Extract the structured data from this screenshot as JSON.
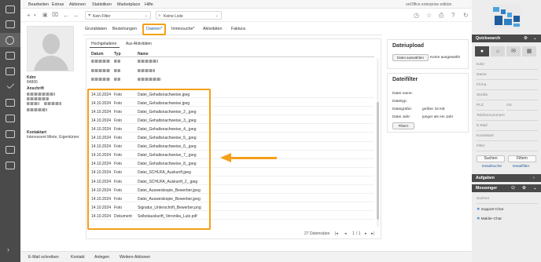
{
  "menu": {
    "items": [
      "Bearbeiten",
      "Extras",
      "Aktionen",
      "Statistiken",
      "Marketplace",
      "Hilfe"
    ],
    "edition": "onOffice enterprise edition"
  },
  "toolbar": {
    "filter_select": "Kein Filter",
    "list_select": "Keine Liste"
  },
  "record": {
    "name_label": "Kdnr",
    "kdnr": "84806",
    "address_label": "Anschrift",
    "contact_label": "Kontaktart",
    "contact_value": "Interessent Miete, Eigentümer"
  },
  "tabs": [
    {
      "label": "Grunddaten"
    },
    {
      "label": "Beziehungen"
    },
    {
      "label": "Dateien*"
    },
    {
      "label": "Immosuche*"
    },
    {
      "label": "Aktivitäten"
    },
    {
      "label": "Faktura"
    }
  ],
  "files": {
    "subtabs": [
      "Hochgeladene",
      "Aus Aktivitäten"
    ],
    "columns": [
      "Datum",
      "Typ",
      "Name"
    ],
    "rows": [
      {
        "date": "14.10.2024",
        "type": "Foto",
        "name": "Datei_Gehaltsnachweise.jpeg"
      },
      {
        "date": "14.10.2024",
        "type": "Foto",
        "name": "Datei_Gehaltsnachweise.jpeg"
      },
      {
        "date": "14.10.2024",
        "type": "Foto",
        "name": "Datei_Gehaltsnachweise_2_.jpeg"
      },
      {
        "date": "14.10.2024",
        "type": "Foto",
        "name": "Datei_Gehaltsnachweise_3_.jpeg"
      },
      {
        "date": "14.10.2024",
        "type": "Foto",
        "name": "Datei_Gehaltsnachweise_4_.jpeg"
      },
      {
        "date": "14.10.2024",
        "type": "Foto",
        "name": "Datei_Gehaltsnachweise_5_.jpeg"
      },
      {
        "date": "14.10.2024",
        "type": "Foto",
        "name": "Datei_Gehaltsnachweise_6_.jpeg"
      },
      {
        "date": "14.10.2024",
        "type": "Foto",
        "name": "Datei_Gehaltsnachweise_7_.jpeg"
      },
      {
        "date": "14.10.2024",
        "type": "Foto",
        "name": "Datei_Gehaltsnachweise_8_.jpeg"
      },
      {
        "date": "14.10.2024",
        "type": "Foto",
        "name": "Datei_SCHUFA_Auskunft.jpeg"
      },
      {
        "date": "14.10.2024",
        "type": "Foto",
        "name": "Datei_SCHUFA_Auskunft_2_.jpeg"
      },
      {
        "date": "14.10.2024",
        "type": "Foto",
        "name": "Datei_Ausweiskopie_Bewerber.jpeg"
      },
      {
        "date": "14.10.2024",
        "type": "Foto",
        "name": "Datei_Ausweiskopie_Bewerber.jpeg"
      },
      {
        "date": "14.10.2024",
        "type": "Foto",
        "name": "Signatur_Unterschrift_Bewerber.png"
      },
      {
        "date": "14.10.2024",
        "type": "Dokument",
        "name": "Selbstauskunft_Veronika_Lutz.pdf"
      }
    ],
    "pager": {
      "count": "27 Datensätze",
      "page": "1",
      "of": "/ 1"
    }
  },
  "upload": {
    "title": "Dateiupload",
    "choose_button": "Datei auswählen",
    "no_file": "Keine ausgewählt"
  },
  "filter": {
    "title": "Dateifilter",
    "fields": [
      {
        "label": "Datei name:",
        "value": ""
      },
      {
        "label": "Dateityp:",
        "value": ""
      },
      {
        "label": "Dateigröße:",
        "value": "größer 15 KB"
      },
      {
        "label": "Datei Jahr:",
        "value": "jünger als ein Jahr"
      }
    ],
    "button": "Filtern"
  },
  "quicksearch": {
    "title": "Quicksearch",
    "fields": [
      "Kdnr",
      "Name",
      "Firma",
      "Straße",
      "PLZ",
      "Ort",
      "Telefonnummern",
      "E-Mail",
      "Kontaktart",
      "Filter"
    ],
    "search_button": "Suchen",
    "filter_button": "Filtern",
    "detail_link": "Detailsuche",
    "detailfilter_link": "Detailfilter"
  },
  "tasks": {
    "title": "Aufgaben"
  },
  "messenger": {
    "title": "Messenger",
    "search_placeholder": "Suchen",
    "items": [
      "Support-Chat",
      "Makler-Chat"
    ]
  },
  "bottom": {
    "items": [
      "E-Mail schreiben",
      "Kontakt",
      "Anlegen",
      "Weitere Aktionen"
    ]
  },
  "colors": {
    "highlight": "#f4a01a",
    "rail": "#4a4a4a",
    "link": "#1e5c9b"
  }
}
